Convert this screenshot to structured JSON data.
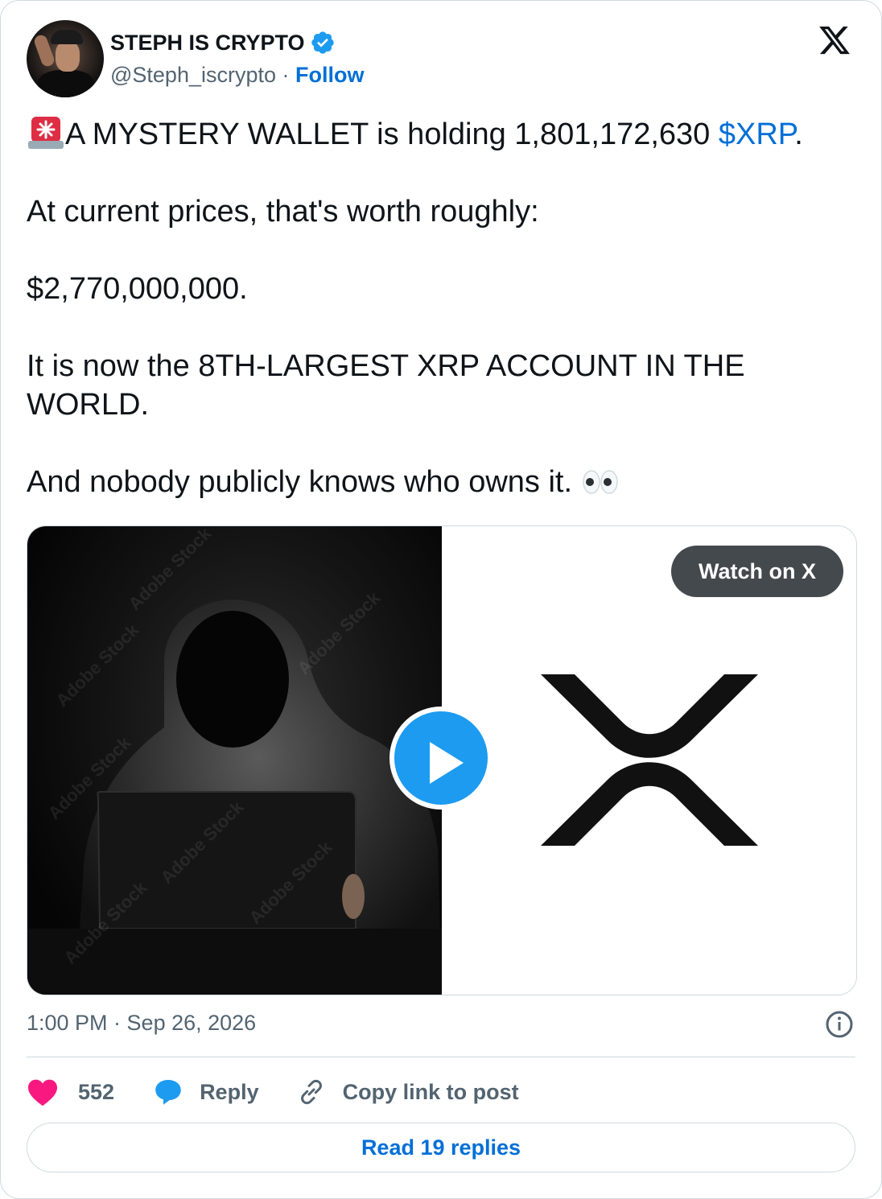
{
  "author": {
    "name": "STEPH IS CRYPTO",
    "handle": "@Steph_iscrypto",
    "separator": "·",
    "follow_label": "Follow"
  },
  "tweet": {
    "line1_prefix": "A MYSTERY WALLET is holding 1,801,172,630 ",
    "line1_cashtag": "$XRP",
    "line1_suffix": ".",
    "line2": "At current prices, that's worth roughly:",
    "line3": "$2,770,000,000.",
    "line4": "It is now the 8TH-LARGEST XRP ACCOUNT IN THE WORLD.",
    "line5": "And nobody publicly knows who owns it. "
  },
  "media": {
    "watch_label": "Watch on X",
    "watermark": "Adobe Stock"
  },
  "meta": {
    "time": "1:00 PM · Sep 26, 2026"
  },
  "actions": {
    "like_count": "552",
    "reply_label": "Reply",
    "copy_label": "Copy link to post"
  },
  "read_replies_label": "Read 19 replies",
  "colors": {
    "link": "#006fd6",
    "like": "#f91880",
    "reply": "#1d9bf0",
    "verified": "#1d9bf0",
    "muted": "#536471"
  }
}
